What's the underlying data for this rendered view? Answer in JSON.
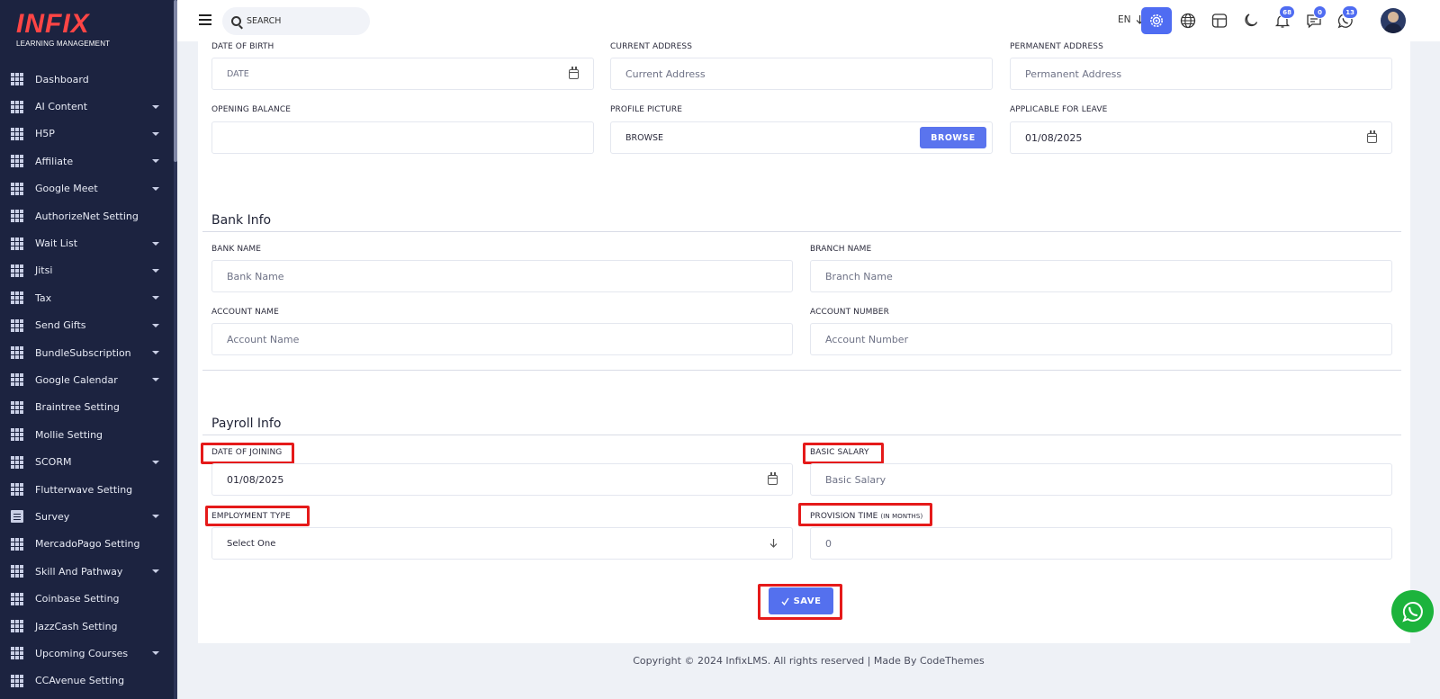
{
  "brand": {
    "logo": "INFIX",
    "subtitle": "LEARNING MANAGEMENT"
  },
  "sidebar": {
    "items": [
      {
        "label": "Dashboard",
        "caret": false,
        "icon": "grid-icon"
      },
      {
        "label": "AI Content",
        "caret": true,
        "icon": "grid-icon"
      },
      {
        "label": "H5P",
        "caret": true,
        "icon": "grid-icon"
      },
      {
        "label": "Affiliate",
        "caret": true,
        "icon": "grid-icon"
      },
      {
        "label": "Google Meet",
        "caret": true,
        "icon": "grid-icon"
      },
      {
        "label": "AuthorizeNet Setting",
        "caret": false,
        "icon": "grid-icon"
      },
      {
        "label": "Wait List",
        "caret": true,
        "icon": "grid-icon"
      },
      {
        "label": "Jitsi",
        "caret": true,
        "icon": "grid-icon"
      },
      {
        "label": "Tax",
        "caret": true,
        "icon": "grid-icon"
      },
      {
        "label": "Send Gifts",
        "caret": true,
        "icon": "grid-icon"
      },
      {
        "label": "BundleSubscription",
        "caret": true,
        "icon": "grid-icon"
      },
      {
        "label": "Google Calendar",
        "caret": true,
        "icon": "grid-icon"
      },
      {
        "label": "Braintree Setting",
        "caret": false,
        "icon": "grid-icon"
      },
      {
        "label": "Mollie Setting",
        "caret": false,
        "icon": "grid-icon"
      },
      {
        "label": "SCORM",
        "caret": true,
        "icon": "grid-icon"
      },
      {
        "label": "Flutterwave Setting",
        "caret": false,
        "icon": "grid-icon"
      },
      {
        "label": "Survey",
        "caret": true,
        "icon": "document-icon"
      },
      {
        "label": "MercadoPago Setting",
        "caret": false,
        "icon": "grid-icon"
      },
      {
        "label": "Skill And Pathway",
        "caret": true,
        "icon": "grid-icon"
      },
      {
        "label": "Coinbase Setting",
        "caret": false,
        "icon": "grid-icon"
      },
      {
        "label": "JazzCash Setting",
        "caret": false,
        "icon": "grid-icon"
      },
      {
        "label": "Upcoming Courses",
        "caret": true,
        "icon": "grid-icon"
      },
      {
        "label": "CCAvenue Setting",
        "caret": false,
        "icon": "grid-icon"
      }
    ]
  },
  "topbar": {
    "search_placeholder": "SEARCH",
    "language": "EN",
    "badges": {
      "notifications": "68",
      "messages": "0",
      "whatsapp": "13"
    }
  },
  "form": {
    "personal": {
      "date_of_birth_label": "DATE OF BIRTH",
      "date_of_birth_placeholder": "DATE",
      "current_address_label": "CURRENT ADDRESS",
      "current_address_placeholder": "Current Address",
      "permanent_address_label": "PERMANENT ADDRESS",
      "permanent_address_placeholder": "Permanent Address",
      "opening_balance_label": "OPENING BALANCE",
      "opening_balance_value": "",
      "profile_picture_label": "PROFILE PICTURE",
      "profile_picture_placeholder": "BROWSE",
      "browse_button": "BROWSE",
      "applicable_for_leave_label": "APPLICABLE FOR LEAVE",
      "applicable_for_leave_value": "01/08/2025"
    },
    "bank": {
      "title": "Bank Info",
      "bank_name_label": "BANK NAME",
      "bank_name_placeholder": "Bank Name",
      "branch_name_label": "BRANCH NAME",
      "branch_name_placeholder": "Branch Name",
      "account_name_label": "ACCOUNT NAME",
      "account_name_placeholder": "Account Name",
      "account_number_label": "ACCOUNT NUMBER",
      "account_number_placeholder": "Account Number"
    },
    "payroll": {
      "title": "Payroll Info",
      "date_of_joining_label": "DATE OF JOINING",
      "date_of_joining_value": "01/08/2025",
      "basic_salary_label": "BASIC SALARY",
      "basic_salary_placeholder": "Basic Salary",
      "employment_type_label": "EMPLOYMENT TYPE",
      "employment_type_value": "Select One",
      "provision_time_label": "PROVISION TIME",
      "provision_time_unit": "(IN MONTHS)",
      "provision_time_value": "0"
    },
    "save_button": "SAVE"
  },
  "footer": {
    "text": "Copyright © 2024 InfixLMS. All rights reserved | Made By CodeThemes"
  },
  "colors": {
    "sidebar_bg": "#1c2340",
    "accent": "#4f6cf2",
    "highlight_box": "#e51a1a",
    "whatsapp": "#1cb33c"
  }
}
